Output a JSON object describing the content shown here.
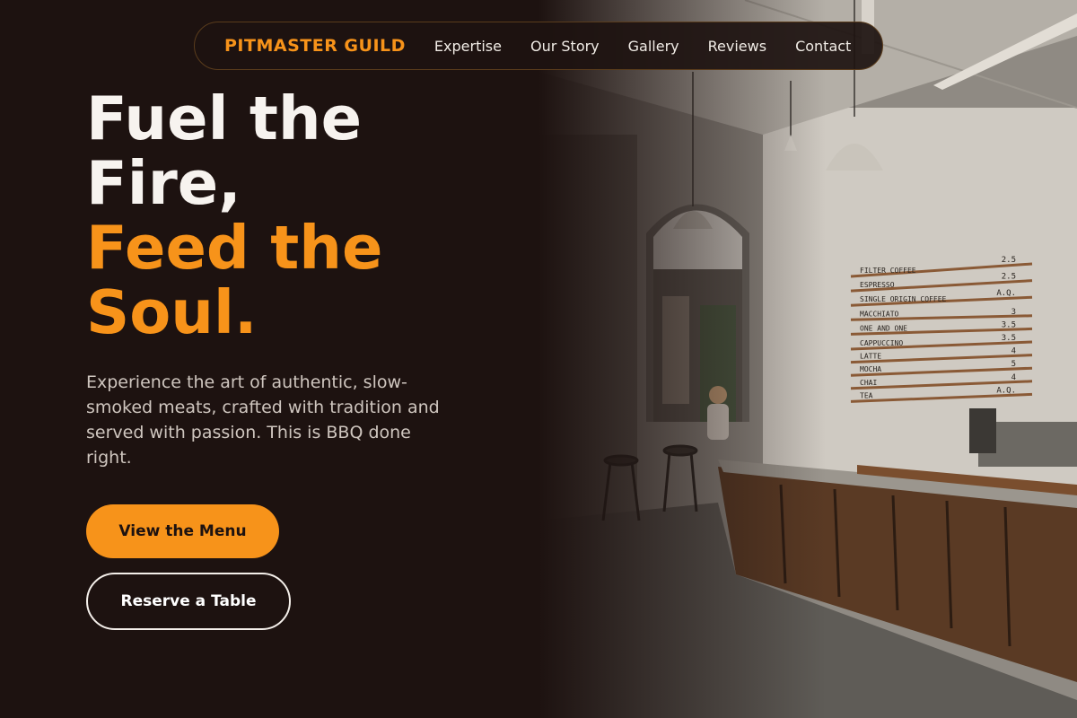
{
  "nav": {
    "brand": "PITMASTER GUILD",
    "links": [
      {
        "label": "Expertise"
      },
      {
        "label": "Our Story"
      },
      {
        "label": "Gallery"
      },
      {
        "label": "Reviews"
      },
      {
        "label": "Contact"
      }
    ]
  },
  "hero": {
    "headline_line1": "Fuel the",
    "headline_line2": "Fire,",
    "headline_accent_line1": "Feed the",
    "headline_accent_line2": "Soul.",
    "description": "Experience the art of authentic, slow-smoked meats, crafted with tradition and served with passion. This is BBQ done right.",
    "primary_cta": "View the Menu",
    "secondary_cta": "Reserve a Table"
  },
  "photo_menu_board": [
    {
      "item": "FILTER COFFEE",
      "price": "2.5"
    },
    {
      "item": "ESPRESSO",
      "price": "2.5"
    },
    {
      "item": "SINGLE ORIGIN COFFEE",
      "price": "A.Q."
    },
    {
      "item": "MACCHIATO",
      "price": "3"
    },
    {
      "item": "ONE AND ONE",
      "price": "3.5"
    },
    {
      "item": "CAPPUCCINO",
      "price": "3.5"
    },
    {
      "item": "LATTE",
      "price": "4"
    },
    {
      "item": "MOCHA",
      "price": "5"
    },
    {
      "item": "CHAI",
      "price": "4"
    },
    {
      "item": "TEA",
      "price": "A.Q."
    }
  ],
  "colors": {
    "background": "#1d1210",
    "accent": "#f7931a",
    "text": "#f7f3ef",
    "muted_text": "#cfc6bf"
  }
}
